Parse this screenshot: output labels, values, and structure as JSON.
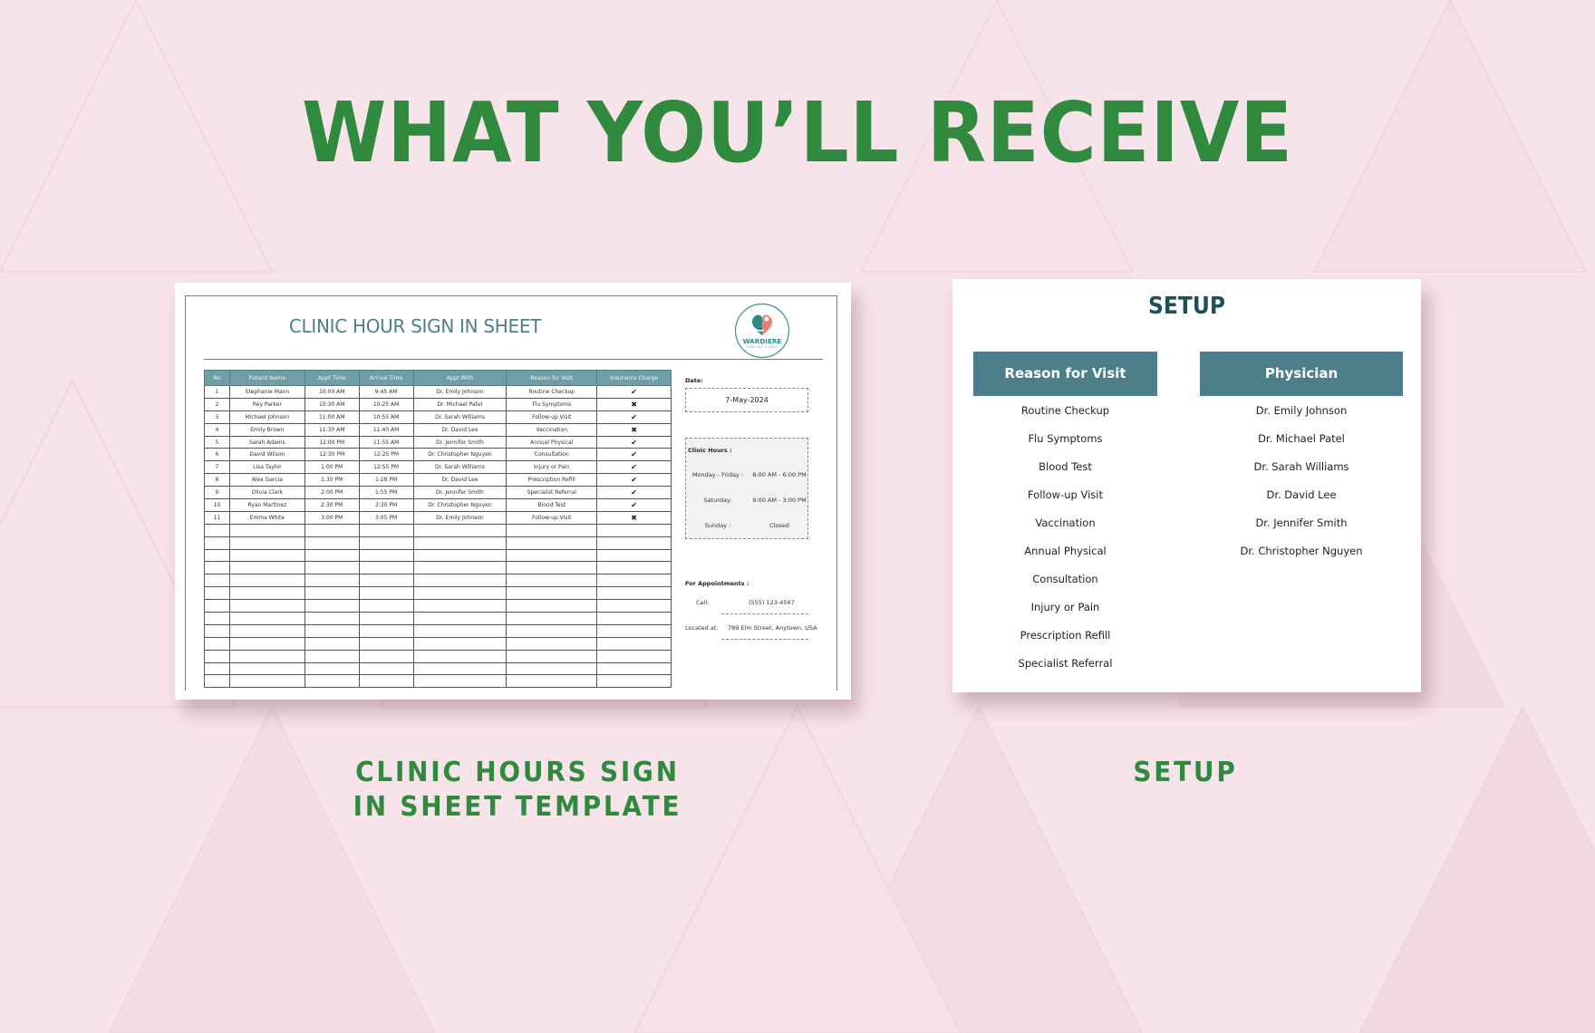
{
  "headline": "WHAT YOU’LL RECEIVE",
  "colors": {
    "accent_green": "#2f8a3e",
    "teal_header": "#4d7f8a",
    "table_header": "#6f9ea7",
    "background": "#f7e3ea",
    "logo_coral": "#ef7b76"
  },
  "sheet": {
    "title": "CLINIC HOUR SIGN IN SHEET",
    "logo": {
      "icon": "heart-hand-logo-icon",
      "name": "WARDIERE",
      "tagline": "MEDICAL CLINIC"
    },
    "table": {
      "columns": [
        "No",
        "Patient Name",
        "Appt Time",
        "Arrival Time",
        "Appt With",
        "Reason for Visit",
        "Insurance Charge"
      ],
      "rows": [
        {
          "no": "1",
          "patient": "Stephanie Mann",
          "appt": "10:00 AM",
          "arrival": "9:45 AM",
          "with": "Dr. Emily Johnson",
          "reason": "Routine Checkup",
          "insurance": "✔"
        },
        {
          "no": "2",
          "patient": "Rey Parker",
          "appt": "10:30 AM",
          "arrival": "10:25 AM",
          "with": "Dr. Michael Patel",
          "reason": "Flu Symptoms",
          "insurance": "✖"
        },
        {
          "no": "3",
          "patient": "Michael Johnson",
          "appt": "11:00 AM",
          "arrival": "10:55 AM",
          "with": "Dr. Sarah Williams",
          "reason": "Follow-up Visit",
          "insurance": "✔"
        },
        {
          "no": "4",
          "patient": "Emily Brown",
          "appt": "11:30 AM",
          "arrival": "11:40 AM",
          "with": "Dr. David Lee",
          "reason": "Vaccination",
          "insurance": "✖"
        },
        {
          "no": "5",
          "patient": "Sarah Adams",
          "appt": "12:00 PM",
          "arrival": "11:55 AM",
          "with": "Dr. Jennifer Smith",
          "reason": "Annual Physical",
          "insurance": "✔"
        },
        {
          "no": "6",
          "patient": "David Wilson",
          "appt": "12:30 PM",
          "arrival": "12:25 PM",
          "with": "Dr. Christopher Nguyen",
          "reason": "Consultation",
          "insurance": "✔"
        },
        {
          "no": "7",
          "patient": "Lisa Taylor",
          "appt": "1:00 PM",
          "arrival": "12:55 PM",
          "with": "Dr. Sarah Williams",
          "reason": "Injury or Pain",
          "insurance": "✔"
        },
        {
          "no": "8",
          "patient": "Alex Garcia",
          "appt": "1:30 PM",
          "arrival": "1:28 PM",
          "with": "Dr. David Lee",
          "reason": "Prescription Refill",
          "insurance": "✔"
        },
        {
          "no": "9",
          "patient": "Olivia Clark",
          "appt": "2:00 PM",
          "arrival": "1:55 PM",
          "with": "Dr. Jennifer Smith",
          "reason": "Specialist Referral",
          "insurance": "✔"
        },
        {
          "no": "10",
          "patient": "Ryan Martinez",
          "appt": "2:30 PM",
          "arrival": "2:30 PM",
          "with": "Dr. Christopher Nguyen",
          "reason": "Blood Test",
          "insurance": "✔"
        },
        {
          "no": "11",
          "patient": "Emma White",
          "appt": "3:00 PM",
          "arrival": "3:05 PM",
          "with": "Dr. Emily Johnson",
          "reason": "Follow-up Visit",
          "insurance": "✖"
        },
        {
          "no": "",
          "patient": "",
          "appt": "",
          "arrival": "",
          "with": "",
          "reason": "",
          "insurance": ""
        },
        {
          "no": "",
          "patient": "",
          "appt": "",
          "arrival": "",
          "with": "",
          "reason": "",
          "insurance": ""
        },
        {
          "no": "",
          "patient": "",
          "appt": "",
          "arrival": "",
          "with": "",
          "reason": "",
          "insurance": ""
        },
        {
          "no": "",
          "patient": "",
          "appt": "",
          "arrival": "",
          "with": "",
          "reason": "",
          "insurance": ""
        },
        {
          "no": "",
          "patient": "",
          "appt": "",
          "arrival": "",
          "with": "",
          "reason": "",
          "insurance": ""
        },
        {
          "no": "",
          "patient": "",
          "appt": "",
          "arrival": "",
          "with": "",
          "reason": "",
          "insurance": ""
        },
        {
          "no": "",
          "patient": "",
          "appt": "",
          "arrival": "",
          "with": "",
          "reason": "",
          "insurance": ""
        },
        {
          "no": "",
          "patient": "",
          "appt": "",
          "arrival": "",
          "with": "",
          "reason": "",
          "insurance": ""
        },
        {
          "no": "",
          "patient": "",
          "appt": "",
          "arrival": "",
          "with": "",
          "reason": "",
          "insurance": ""
        },
        {
          "no": "",
          "patient": "",
          "appt": "",
          "arrival": "",
          "with": "",
          "reason": "",
          "insurance": ""
        },
        {
          "no": "",
          "patient": "",
          "appt": "",
          "arrival": "",
          "with": "",
          "reason": "",
          "insurance": ""
        },
        {
          "no": "",
          "patient": "",
          "appt": "",
          "arrival": "",
          "with": "",
          "reason": "",
          "insurance": ""
        },
        {
          "no": "",
          "patient": "",
          "appt": "",
          "arrival": "",
          "with": "",
          "reason": "",
          "insurance": ""
        }
      ]
    },
    "date_label": "Date:",
    "date_value": "7-May-2024",
    "clinic_hours": {
      "title": "Clinic Hours :",
      "rows": [
        {
          "day": "Monday - Friday :",
          "time": "8:00 AM - 6:00 PM"
        },
        {
          "day": "Saturday:",
          "time": "9:00 AM - 3:00 PM"
        },
        {
          "day": "Sunday :",
          "time": "Closed"
        }
      ]
    },
    "appointments": {
      "title": "For Appointments :",
      "call_label": "Call:",
      "call_value": "(555) 123-4567",
      "location_label": "Located at:",
      "location_value": "789 Elm Street, Anytown, USA"
    }
  },
  "setup": {
    "title": "SETUP",
    "reason_header": "Reason for Visit",
    "reasons": [
      "Routine Checkup",
      "Flu Symptoms",
      "Blood Test",
      "Follow-up Visit",
      "Vaccination",
      "Annual Physical",
      "Consultation",
      "Injury or Pain",
      "Prescription Refill",
      "Specialist Referral"
    ],
    "physician_header": "Physician",
    "physicians": [
      "Dr. Emily Johnson",
      "Dr. Michael Patel",
      "Dr. Sarah Williams",
      "Dr. David Lee",
      "Dr. Jennifer Smith",
      "Dr. Christopher Nguyen"
    ]
  },
  "captions": {
    "left_line1": "CLINIC HOURS SIGN",
    "left_line2": "IN SHEET TEMPLATE",
    "right": "SETUP"
  }
}
